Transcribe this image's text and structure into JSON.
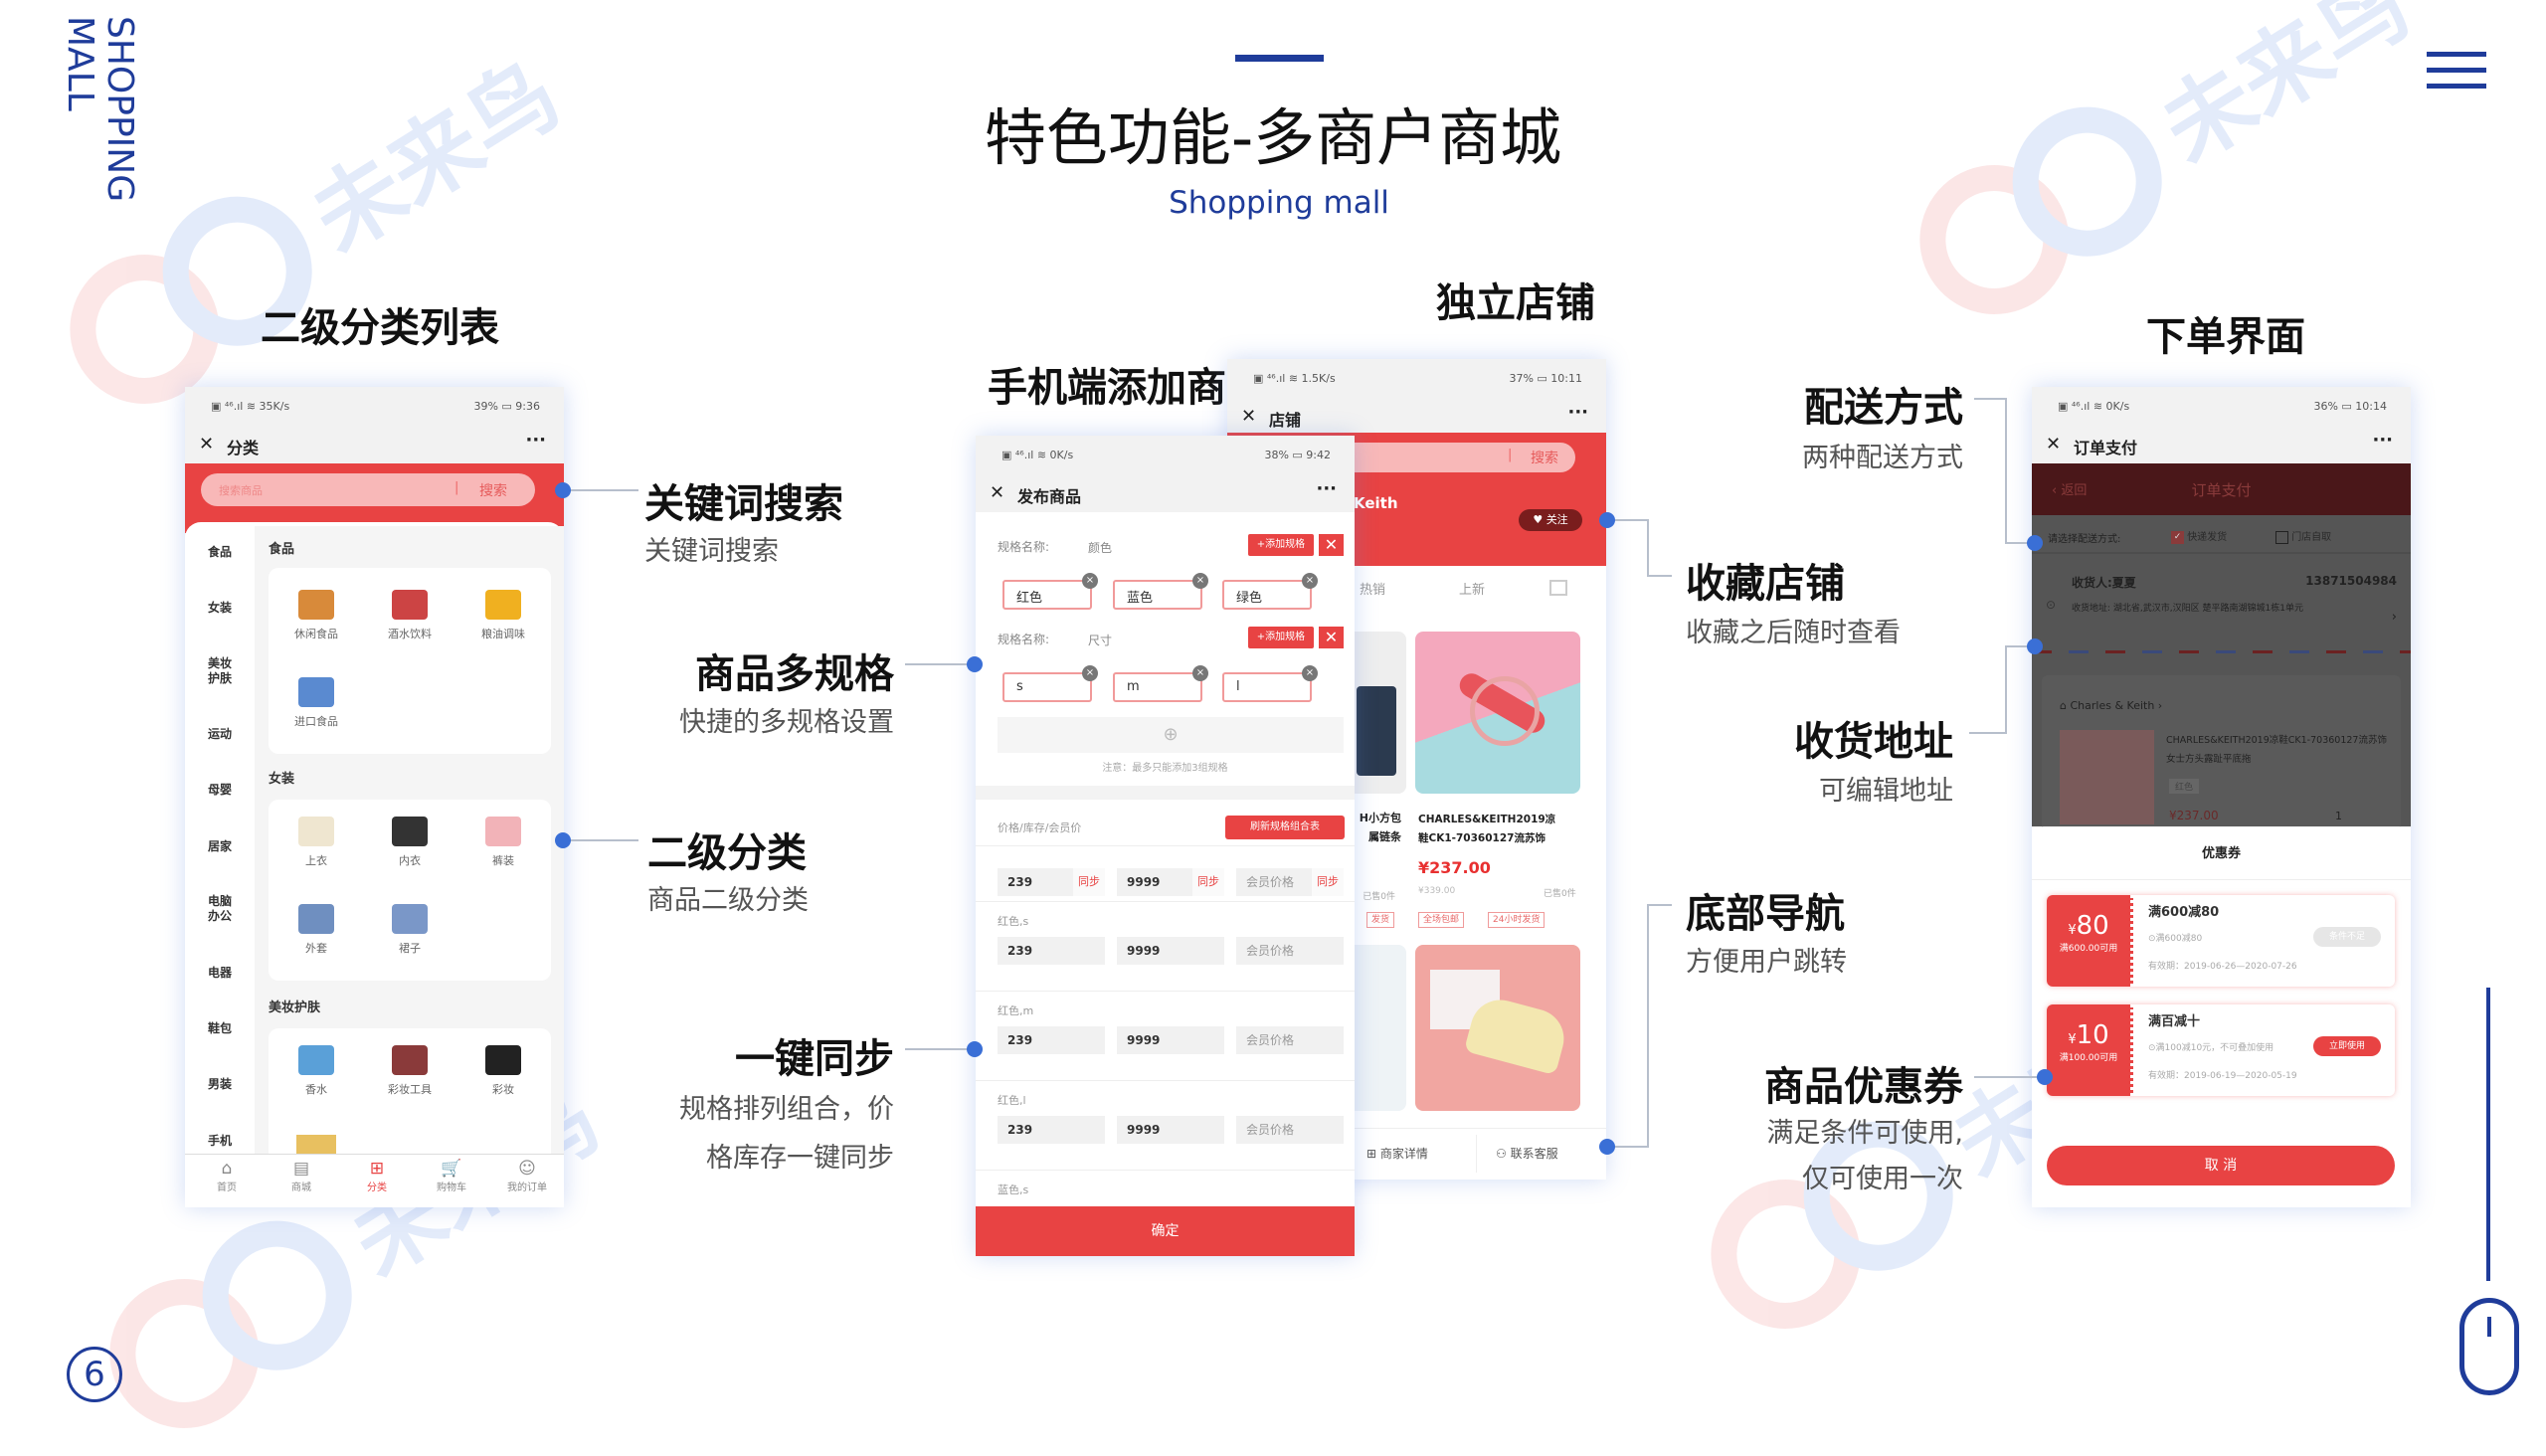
{
  "brand_vertical": "SHOPPING MALL",
  "title": "特色功能-多商户商城",
  "subtitle": "Shopping mall",
  "page_number": "6",
  "watermark": "未来鸟",
  "colors": {
    "accent_blue": "#1f3c9a",
    "dot_blue": "#3a6fd6",
    "app_red": "#e84343"
  },
  "icons": {
    "menu": "hamburger-icon",
    "scroll": "mouse-icon"
  },
  "headings": {
    "category_list": "二级分类列表",
    "add_product": "手机端添加商品",
    "store": "独立店铺",
    "order": "下单界面"
  },
  "annotations": {
    "keyword_search": {
      "title": "关键词搜索",
      "desc": "关键词搜索"
    },
    "multi_spec": {
      "title": "商品多规格",
      "desc": "快捷的多规格设置"
    },
    "sub_category": {
      "title": "二级分类",
      "desc": "商品二级分类"
    },
    "one_click_sync": {
      "title": "一键同步",
      "desc_1": "规格排列组合，价",
      "desc_2": "格库存一键同步"
    },
    "delivery": {
      "title": "配送方式",
      "desc": "两种配送方式"
    },
    "favorite_store": {
      "title": "收藏店铺",
      "desc": "收藏之后随时查看"
    },
    "address": {
      "title": "收货地址",
      "desc": "可编辑地址"
    },
    "bottom_nav": {
      "title": "底部导航",
      "desc": "方便用户跳转"
    },
    "coupon": {
      "title": "商品优惠券",
      "desc_1": "满足条件可使用,",
      "desc_2": "仅可使用一次"
    }
  },
  "phone_category": {
    "status_left": "▣ ⁴⁶.ıl ≋ 35K/s",
    "status_right": "39% ▭ 9:36",
    "title": "分类",
    "search_placeholder": "搜索商品",
    "search_button": "搜索",
    "categories": [
      "食品",
      "女装",
      "美妆\n护肤",
      "运动",
      "母婴",
      "居家",
      "电脑\n办公",
      "电器",
      "鞋包",
      "男装",
      "手机"
    ],
    "sections": [
      {
        "title": "食品",
        "items": [
          "休闲食品",
          "酒水饮料",
          "粮油调味",
          "进口食品"
        ]
      },
      {
        "title": "女装",
        "items": [
          "上衣",
          "内衣",
          "裤装",
          "外套",
          "裙子"
        ]
      },
      {
        "title": "美妆护肤",
        "items": [
          "香水",
          "彩妆工具",
          "彩妆"
        ]
      }
    ],
    "nav": [
      {
        "label": "首页",
        "icon": "home-icon",
        "glyph": "⌂"
      },
      {
        "label": "商城",
        "icon": "store-icon",
        "glyph": "▤"
      },
      {
        "label": "分类",
        "icon": "category-icon",
        "glyph": "⊞",
        "active": true
      },
      {
        "label": "购物车",
        "icon": "cart-icon",
        "glyph": "🛒"
      },
      {
        "label": "我的订单",
        "icon": "smile-icon",
        "glyph": "☺"
      }
    ]
  },
  "phone_add_product": {
    "status_left": "▣ ⁴⁶.ıl ≋ 0K/s",
    "status_right": "38% ▭ 9:42",
    "title": "发布商品",
    "spec_label": "规格名称:",
    "spec1_name": "颜色",
    "spec1_values": [
      "红色",
      "蓝色",
      "绿色"
    ],
    "spec2_name": "尺寸",
    "spec2_values": [
      "s",
      "m",
      "l"
    ],
    "add_spec": "+添加规格",
    "note": "注意：最多只能添加3组规格",
    "price_header": "价格/库存/会员价",
    "refresh_button": "刷新规格组合表",
    "sync_label": "同步",
    "price": "239",
    "stock": "9999",
    "member_placeholder": "会员价格",
    "combos": [
      "红色,s",
      "红色,m",
      "红色,l",
      "蓝色,s"
    ],
    "confirm": "确定"
  },
  "phone_store": {
    "status_left": "▣ ⁴⁶.ıl ≋ 1.5K/s",
    "status_right": "37% ▭ 10:11",
    "title": "店铺",
    "search_button": "搜索",
    "store_name": "Charles & Keith",
    "follow": "关注",
    "tabs": [
      "热销",
      "上新"
    ],
    "left_product": {
      "line1": "H小方包",
      "line2": "属链条",
      "sold": "已售0件",
      "tag": "发货"
    },
    "product": {
      "line1": "CHARLES&KEITH2019凉",
      "line2": "鞋CK1-70360127流苏饰",
      "price": "¥237.00",
      "old_price": "¥339.00",
      "sold": "已售0件",
      "tags": [
        "全场包邮",
        "24小时发货"
      ]
    },
    "bottom": [
      "商家详情",
      "联系客服"
    ]
  },
  "phone_order": {
    "status_left": "▣ ⁴⁶.ıl ≋ 0K/s",
    "status_right": "36% ▭ 10:14",
    "title": "订单支付",
    "back": "返回",
    "header": "订单支付",
    "delivery_label": "请选择配送方式:",
    "delivery_options": [
      {
        "label": "快递发货",
        "checked": true
      },
      {
        "label": "门店自取",
        "checked": false
      }
    ],
    "receiver": "收货人:夏夏",
    "phone": "13871504984",
    "address_label": "收货地址:",
    "address": "湖北省,武汉市,汉阳区 楚平路南湖锦城1栋1单元",
    "shop": "Charles & Keith",
    "product_title": "CHARLES&KEITH2019凉鞋CK1-70360127流苏饰女士方头露趾平底拖",
    "product_color": "红色",
    "product_price": "¥237.00",
    "qty": "1",
    "coupon_title": "优惠券",
    "coupons": [
      {
        "amount": "80",
        "condition": "满600.00可用",
        "name": "满600减80",
        "desc": "⊙满600减80",
        "valid": "有效期：2019-06-26—2020-07-26",
        "button": "条件不足",
        "usable": false
      },
      {
        "amount": "10",
        "condition": "满100.00可用",
        "name": "满百减十",
        "desc": "⊙满100减10元，不可叠加使用",
        "valid": "有效期：2019-06-19—2020-05-19",
        "button": "立即使用",
        "usable": true
      }
    ],
    "cancel": "取 消"
  }
}
